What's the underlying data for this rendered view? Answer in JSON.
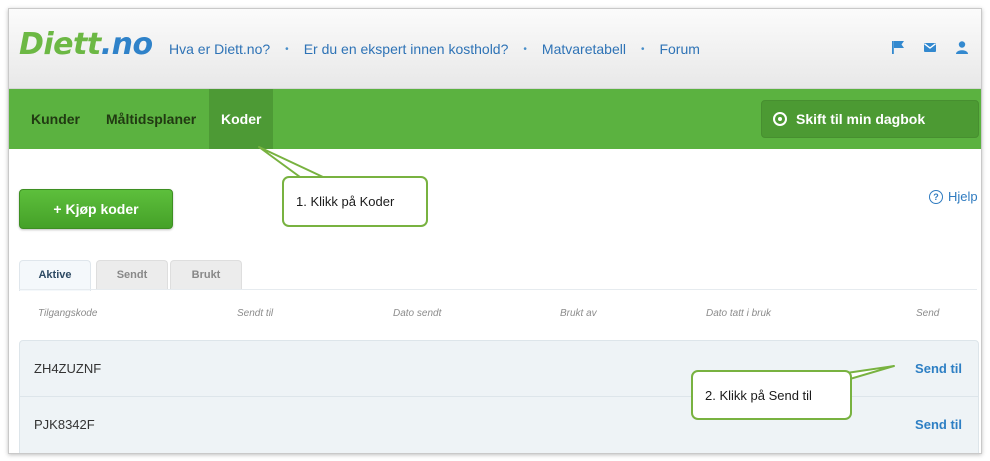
{
  "logo": {
    "name": "Diett",
    "dot": ".",
    "tld": "no"
  },
  "topnav": [
    {
      "label": "Hva er Diett.no?"
    },
    {
      "label": "Er du en ekspert innen kosthold?"
    },
    {
      "label": "Matvaretabell"
    },
    {
      "label": "Forum"
    }
  ],
  "nav_separator": "•",
  "topicons": [
    "flag-icon",
    "mail-icon",
    "user-icon"
  ],
  "main_tabs": [
    {
      "label": "Kunder",
      "active": false
    },
    {
      "label": "Måltidsplaner",
      "active": false
    },
    {
      "label": "Koder",
      "active": true
    }
  ],
  "diary_button": {
    "label": "Skift til min dagbok",
    "icon": "target-icon"
  },
  "buy_button": {
    "label": "+ Kjøp koder"
  },
  "help_link": {
    "label": "Hjelp",
    "icon": "question-icon",
    "glyph": "?"
  },
  "sub_tabs": [
    {
      "label": "Aktive",
      "active": true
    },
    {
      "label": "Sendt",
      "active": false
    },
    {
      "label": "Brukt",
      "active": false
    }
  ],
  "table": {
    "columns": [
      "Tilgangskode",
      "Sendt til",
      "Dato sendt",
      "Brukt av",
      "Dato tatt i bruk",
      "Send"
    ],
    "rows": [
      {
        "code": "ZH4ZUZNF",
        "action": "Send til"
      },
      {
        "code": "PJK8342F",
        "action": "Send til"
      }
    ]
  },
  "callouts": [
    {
      "text": "1. Klikk på Koder"
    },
    {
      "text": "2. Klikk på Send til"
    }
  ],
  "colors": {
    "green_bar": "#5bb240",
    "active_tab": "#4d9a35",
    "link_blue": "#2e73b6",
    "callout_border": "#78b240"
  }
}
